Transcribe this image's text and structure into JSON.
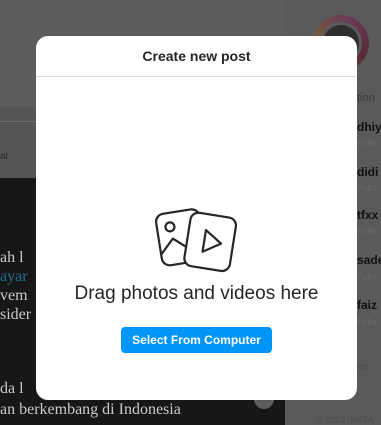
{
  "background": {
    "feed_lines": [
      "ah l",
      "ayar",
      "vem",
      "sider",
      "da l",
      "an berkembang di Indonesia"
    ],
    "side_label": "tion",
    "side_users": [
      {
        "name": "dhiy",
        "sub": "Follo"
      },
      {
        "name": "didi",
        "sub": "Follo"
      },
      {
        "name": "tfxx",
        "sub": "Follo"
      },
      {
        "name": "sade",
        "sub": "Follo"
      },
      {
        "name": "faiz",
        "sub": "Follo"
      }
    ],
    "side_help": "elp",
    "side_footer": "© 2022 INSTA",
    "left_label": "al"
  },
  "modal": {
    "title": "Create new post",
    "drag_text": "Drag photos and videos here",
    "select_button_label": "Select From Computer",
    "icon": "photo-video-icon",
    "accent_color": "#0095f6"
  }
}
